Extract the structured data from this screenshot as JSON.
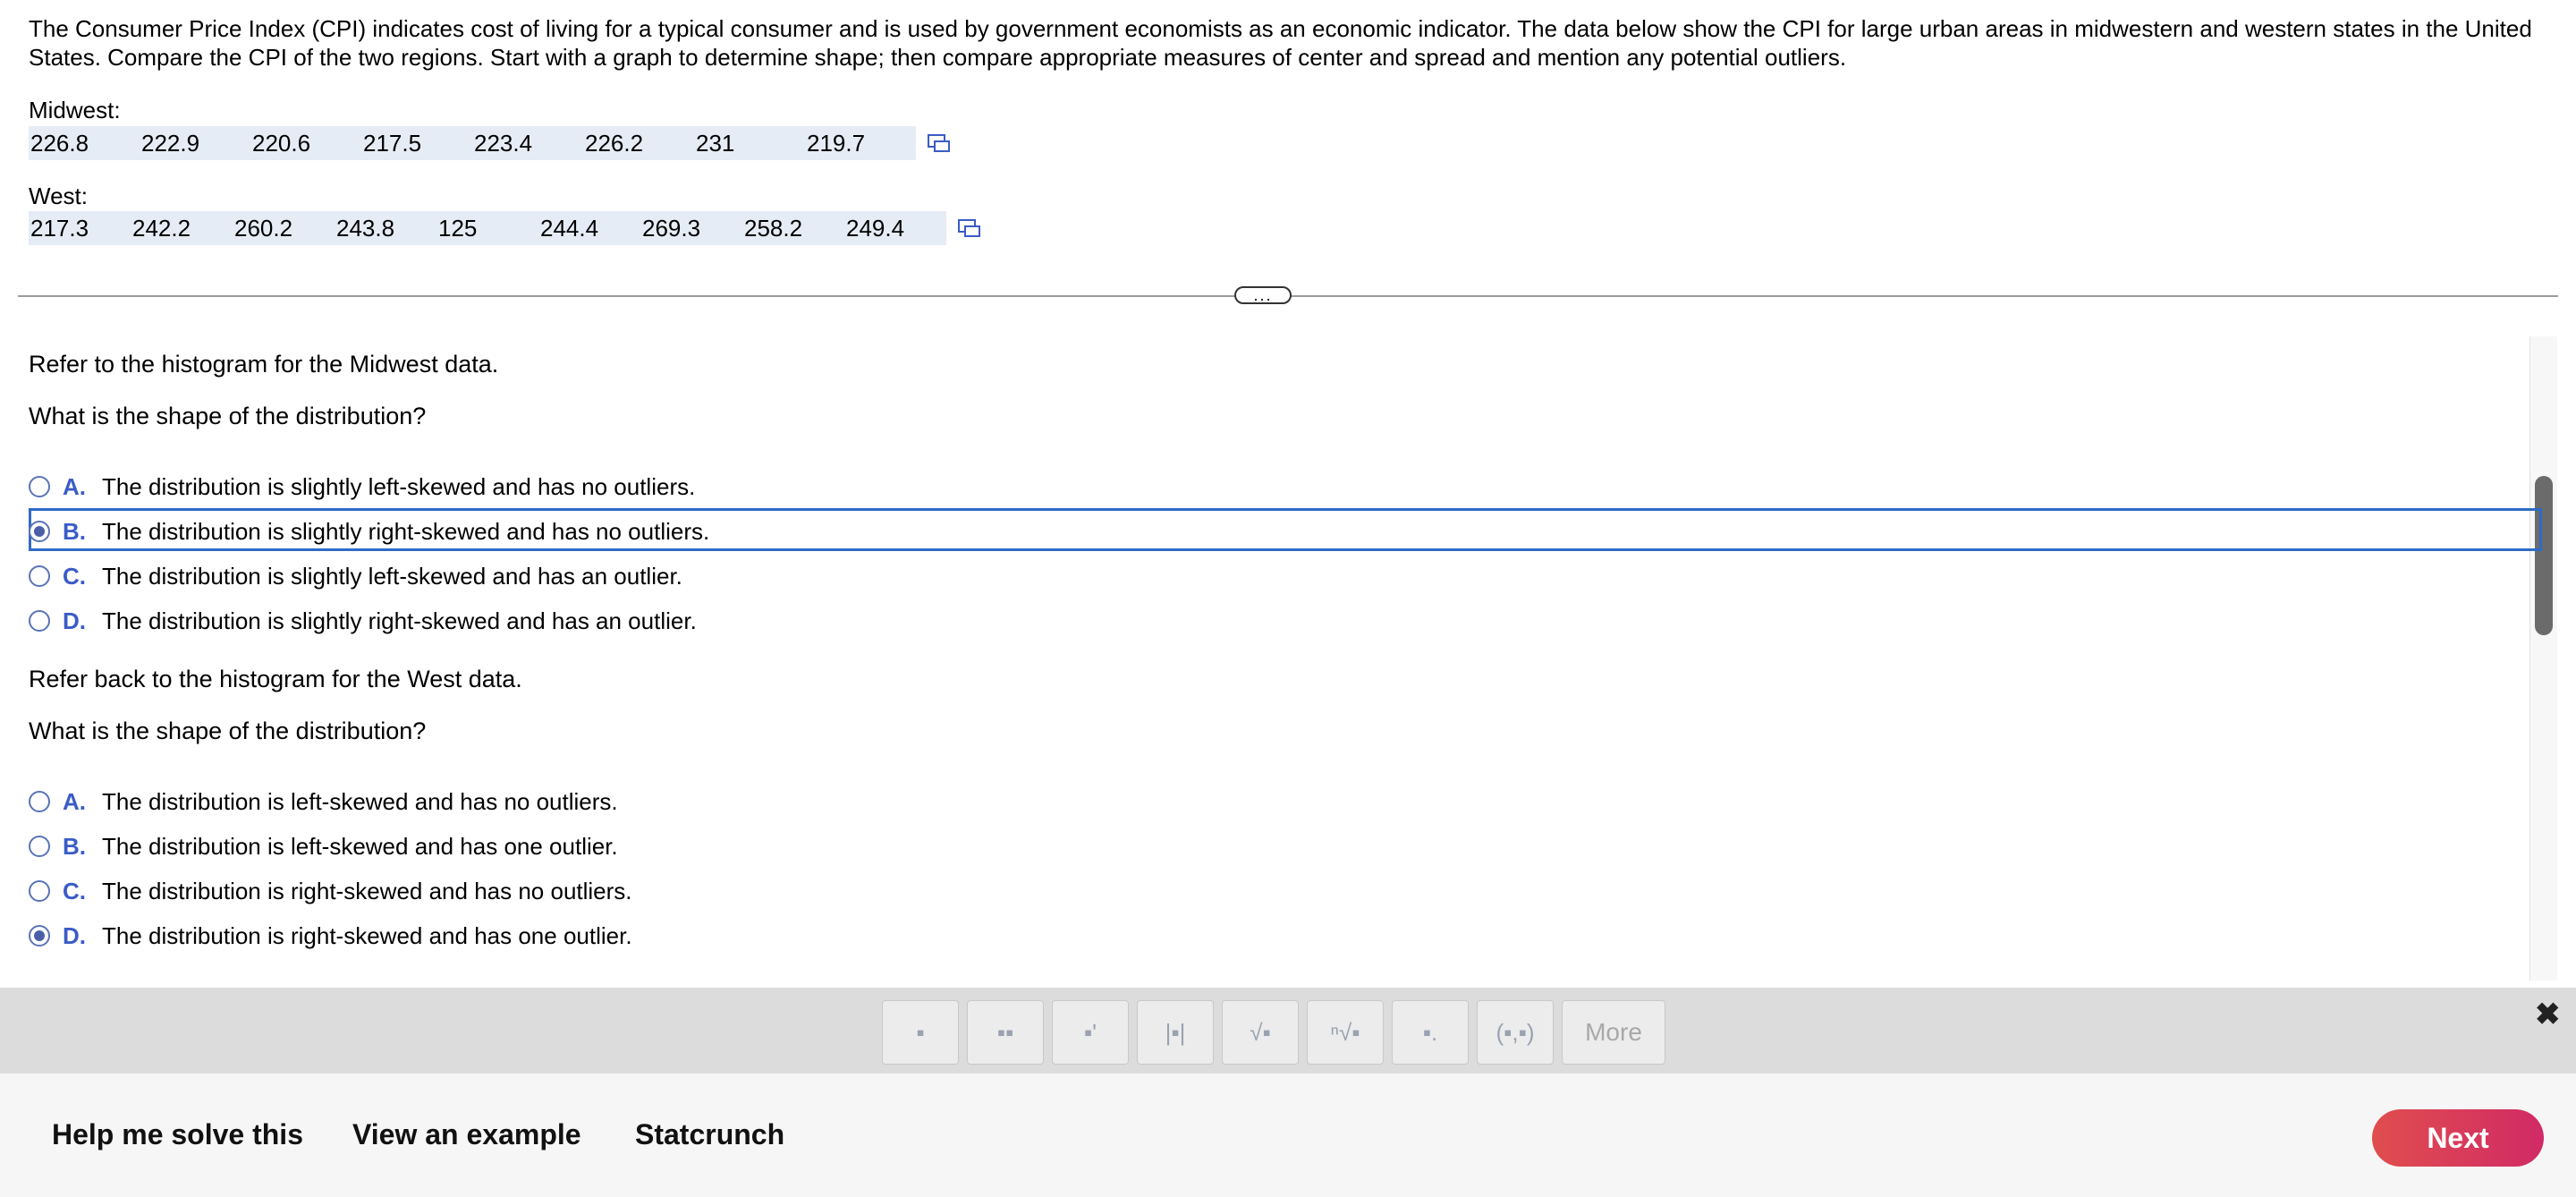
{
  "intro": "The Consumer Price Index (CPI) indicates cost of living for a typical consumer and is used by government economists as an economic indicator. The data below show the CPI for large urban areas in midwestern and western states in the United States. Compare the CPI of the two regions. Start with a graph to determine shape; then compare appropriate measures of center and spread and mention any potential outliers.",
  "midwest": {
    "label": "Midwest:",
    "values": [
      "226.8",
      "222.9",
      "220.6",
      "217.5",
      "223.4",
      "226.2",
      "231",
      "219.7"
    ]
  },
  "west": {
    "label": "West:",
    "values": [
      "217.3",
      "242.2",
      "260.2",
      "243.8",
      "125",
      "244.4",
      "269.3",
      "258.2",
      "249.4"
    ]
  },
  "question1": {
    "refer": "Refer to the histogram for the Midwest data.",
    "prompt": "What is the shape of the distribution?",
    "options": [
      {
        "letter": "A.",
        "text": "The distribution is slightly left-skewed and has no outliers.",
        "selected": false
      },
      {
        "letter": "B.",
        "text": "The distribution is slightly right-skewed and has no outliers.",
        "selected": true
      },
      {
        "letter": "C.",
        "text": "The distribution is slightly left-skewed and has an outlier.",
        "selected": false
      },
      {
        "letter": "D.",
        "text": "The distribution is slightly right-skewed and has an outlier.",
        "selected": false
      }
    ]
  },
  "question2": {
    "refer": "Refer back to the histogram for the West data.",
    "prompt": "What is the shape of the distribution?",
    "options": [
      {
        "letter": "A.",
        "text": "The distribution is left-skewed and has no outliers.",
        "selected": false
      },
      {
        "letter": "B.",
        "text": "The distribution is left-skewed and has one outlier.",
        "selected": false
      },
      {
        "letter": "C.",
        "text": "The distribution is right-skewed and has no outliers.",
        "selected": false
      },
      {
        "letter": "D.",
        "text": "The distribution is right-skewed and has one outlier.",
        "selected": true
      }
    ]
  },
  "divider_handle": "...",
  "toolbar": {
    "tools": [
      "fraction-icon",
      "mixed-number-icon",
      "exponent-icon",
      "absolute-value-icon",
      "sqrt-icon",
      "nth-root-icon",
      "subscript-icon",
      "ordered-pair-icon"
    ],
    "tool_glyphs": [
      "▪",
      "▪▪",
      "▪'",
      "|▪|",
      "√▪",
      "ⁿ√▪",
      "▪.",
      "(▪,▪)"
    ],
    "more_label": "More",
    "close_glyph": "✖"
  },
  "footer": {
    "help_label": "Help me solve this",
    "example_label": "View an example",
    "statcrunch_label": "Statcrunch",
    "next_label": "Next"
  },
  "colors": {
    "accent": "#2e6bc6",
    "letter": "#3a5cc6",
    "next_start": "#e04e4e",
    "next_end": "#d12a66"
  }
}
